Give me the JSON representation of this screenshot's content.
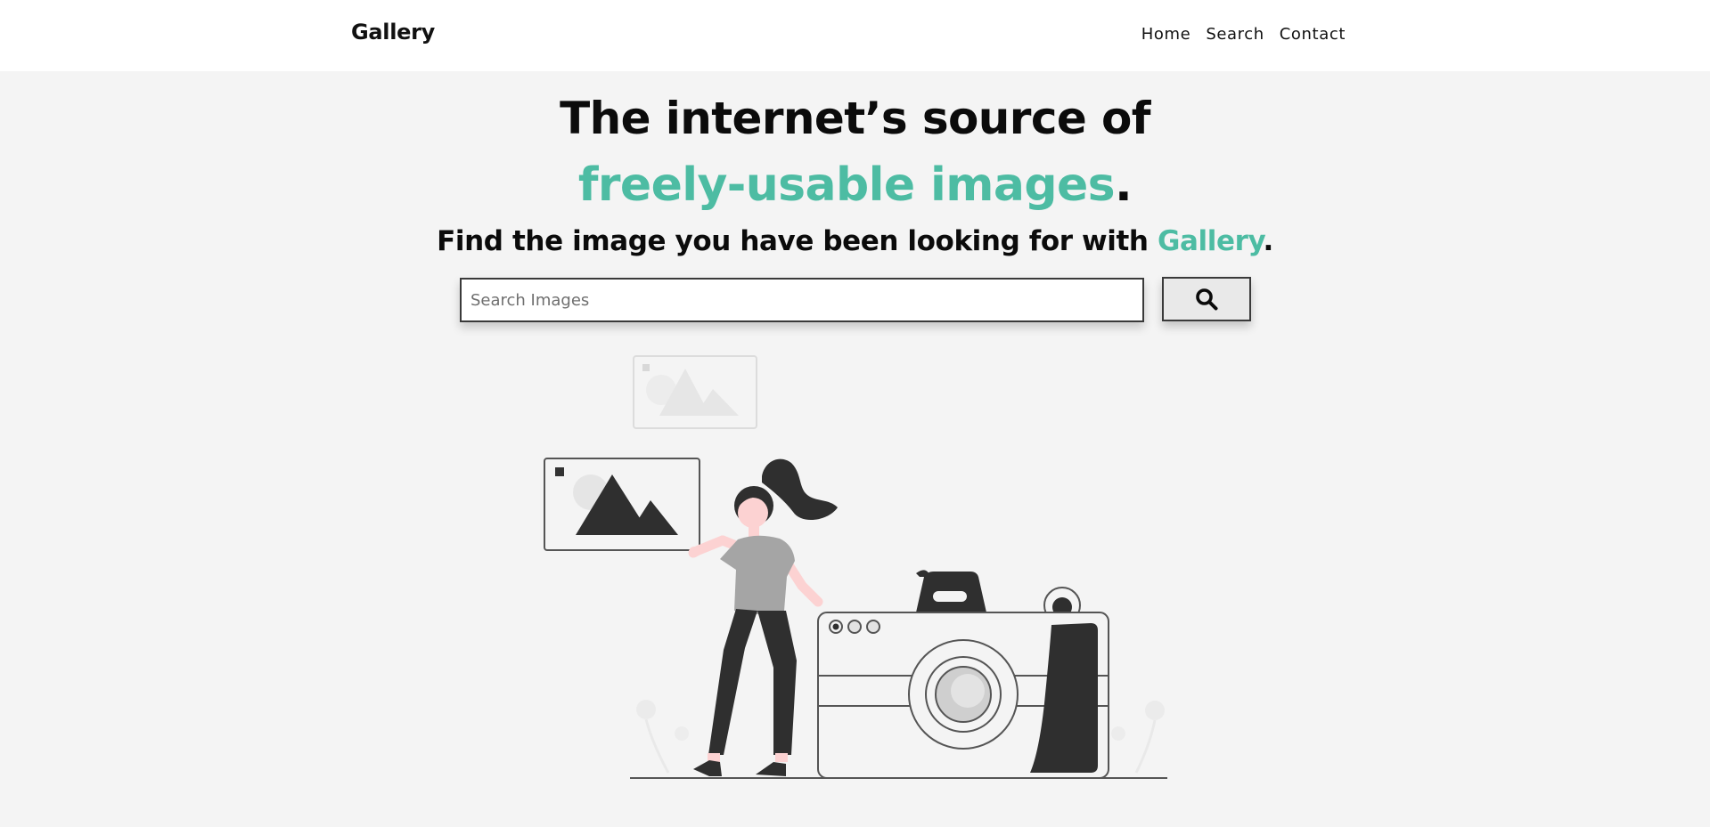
{
  "header": {
    "brand": "Gallery",
    "nav": [
      "Home",
      "Search",
      "Contact"
    ]
  },
  "hero": {
    "line1": "The internet’s source of",
    "line2_accent": "freely-usable images",
    "line2_end": ".",
    "sub_prefix": "Find the image you have been looking for with ",
    "sub_accent": "Gallery",
    "sub_end": "."
  },
  "search": {
    "placeholder": "Search Images",
    "value": "",
    "button_icon": "search-icon"
  },
  "illustration": {
    "icon": "woman-camera-illustration"
  },
  "colors": {
    "accent": "#4dbca3",
    "background": "#f4f4f4",
    "header_bg": "#ffffff",
    "text": "#0b0b0b"
  }
}
